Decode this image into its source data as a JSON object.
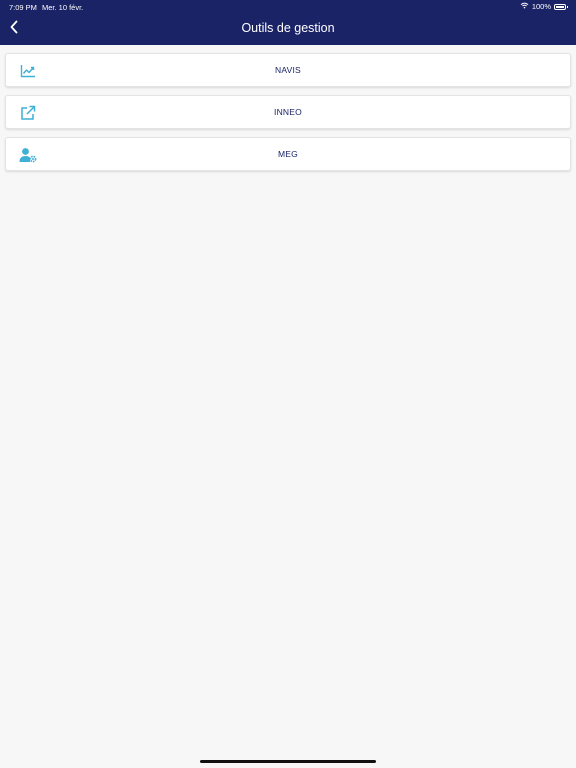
{
  "status_bar": {
    "time": "7:09 PM",
    "date": "Mer. 10 févr.",
    "battery": "100%"
  },
  "header": {
    "title": "Outils de gestion",
    "back_icon": "chevron-left-icon"
  },
  "items": [
    {
      "label": "NAVIS",
      "icon": "chart-line-icon"
    },
    {
      "label": "INNEO",
      "icon": "external-link-icon"
    },
    {
      "label": "MEG",
      "icon": "user-gear-icon"
    }
  ],
  "colors": {
    "header_bg": "#1b2367",
    "accent_icon": "#3fb0d6",
    "label_text": "#1b2367",
    "background": "#f7f7f7"
  }
}
